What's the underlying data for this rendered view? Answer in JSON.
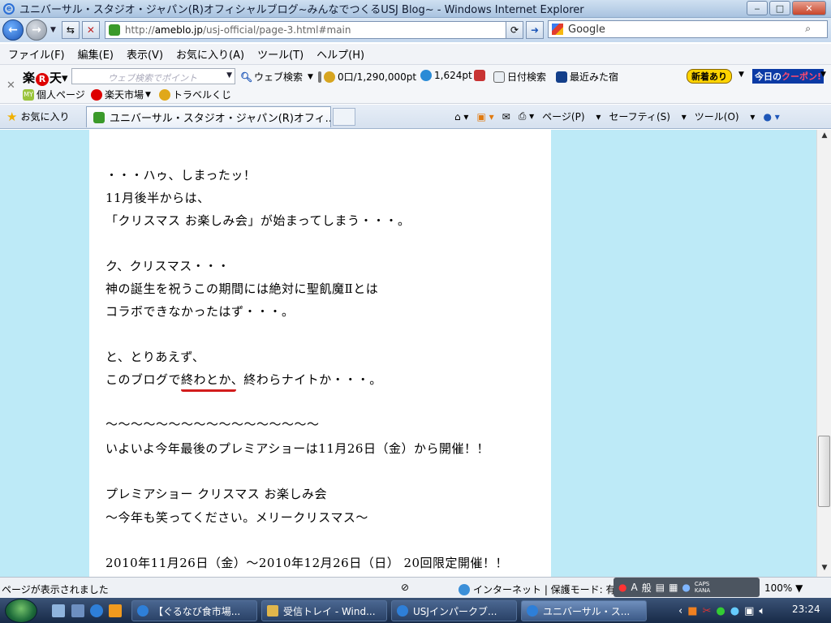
{
  "window": {
    "title": "ユニバーサル・スタジオ・ジャパン(R)オフィシャルブログ~みんなでつくるUSJ Blog~ - Windows Internet Explorer",
    "minimize": "‒",
    "maximize": "□",
    "close": "✕"
  },
  "address": {
    "protocol": "http://",
    "domain": "ameblo.jp",
    "path": "/usj-official/page-3.html#main"
  },
  "search": {
    "engine": "Google"
  },
  "menu": [
    "ファイル(F)",
    "編集(E)",
    "表示(V)",
    "お気に入り(A)",
    "ツール(T)",
    "ヘルプ(H)"
  ],
  "rakuten": {
    "logo_a": "楽",
    "logo_r": "R",
    "logo_b": "天",
    "search_placeholder": "ウェブ検索でポイント",
    "web_search": "ウェブ検索",
    "points": "0口/1,290,000pt",
    "pt": "1,624pt",
    "date_search": "日付検索",
    "recent_inn": "最近みた宿",
    "new_badge": "新着あり",
    "today_a": "今日の",
    "today_b": "クーポン!",
    "personal_page": "個人ページ",
    "market": "楽天市場",
    "travel_lottery": "トラベルくじ"
  },
  "favbar": {
    "favorites": "お気に入り",
    "tab_title": "ユニバーサル・スタジオ・ジャパン(R)オフィ...",
    "page": "ページ(P)",
    "safety": "セーフティ(S)",
    "tools": "ツール(O)"
  },
  "article": {
    "lines": [
      "・・・ハゥ、しまったッ！",
      "11月後半からは、",
      "「クリスマス お楽しみ会」が始まってしまう・・・。",
      "ク、クリスマス・・・",
      "神の誕生を祝うこの期間には絶対に聖飢魔Ⅱとは",
      "コラボできなかったはず・・・。",
      "と、とりあえず、",
      "このブログで終わとか、終わらナイトか・・・。",
      "～～～～～～～～～～～～～～～～～",
      "いよいよ今年最後のプレミアショーは11月26日（金）から開催！！",
      "プレミアショー クリスマス お楽しみ会",
      "～今年も笑ってください。メリークリスマス～",
      "2010年11月26日（金）～2010年12月26日（日） 20回限定開催！！"
    ]
  },
  "status": {
    "left": "ページが表示されました",
    "zone": "インターネット | 保護モード: 有効",
    "zoom": "100%"
  },
  "langbar": {
    "a": "A",
    "mode": "般",
    "caps": "CAPS",
    "kana": "KANA"
  },
  "taskbar": {
    "tasks": [
      "【ぐるなび食市場...",
      "受信トレイ - Wind...",
      "USJインパークブ...",
      "ユニバーサル・ス..."
    ],
    "clock": "23:24"
  }
}
